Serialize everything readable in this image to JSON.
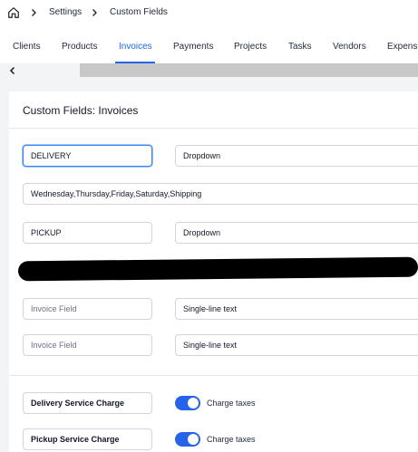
{
  "breadcrumb": {
    "home_icon": "home-icon",
    "separator_icon": "chevron-right-icon",
    "items": [
      "Settings",
      "Custom Fields"
    ]
  },
  "tabs": [
    {
      "label": "Clients",
      "active": false
    },
    {
      "label": "Products",
      "active": false
    },
    {
      "label": "Invoices",
      "active": true
    },
    {
      "label": "Payments",
      "active": false
    },
    {
      "label": "Projects",
      "active": false
    },
    {
      "label": "Tasks",
      "active": false
    },
    {
      "label": "Vendors",
      "active": false
    },
    {
      "label": "Expens",
      "active": false
    }
  ],
  "scroll_left_icon": "chevron-left-icon",
  "card": {
    "title": "Custom Fields: Invoices",
    "fields": [
      {
        "name": "DELIVERY",
        "type": "Dropdown"
      },
      {
        "options": "Wednesday,Thursday,Friday,Saturday,Shipping"
      },
      {
        "name": "PICKUP",
        "type": "Dropdown"
      },
      {
        "name_placeholder": "Invoice Field",
        "type": "Single-line text"
      },
      {
        "name_placeholder": "Invoice Field",
        "type": "Single-line text"
      }
    ],
    "surcharges": [
      {
        "label": "Delivery Service Charge",
        "toggle_label": "Charge taxes",
        "enabled": true
      },
      {
        "label": "Pickup Service Charge",
        "toggle_label": "Charge taxes",
        "enabled": true
      }
    ]
  },
  "colors": {
    "accent": "#2563eb",
    "background": "#f3f4f6",
    "card": "#ffffff",
    "border": "#d1d5db"
  }
}
